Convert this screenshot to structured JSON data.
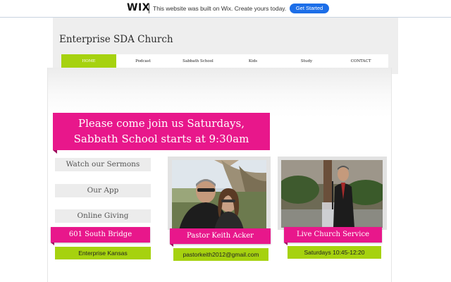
{
  "wix_banner": {
    "logo": "WIX",
    "message": "This website was built on Wix. Create yours today.",
    "cta": "Get Started"
  },
  "site": {
    "title": "Enterprise SDA Church"
  },
  "nav": {
    "items": [
      {
        "label": "HOME",
        "active": true
      },
      {
        "label": "Podcast",
        "active": false
      },
      {
        "label": "Sabbath School",
        "active": false
      },
      {
        "label": "Kids",
        "active": false
      },
      {
        "label": "Study",
        "active": false
      },
      {
        "label": "CONTACT",
        "active": false
      }
    ]
  },
  "hero": {
    "line1": "Please come join us Saturdays,",
    "line2": "Sabbath School starts at 9:30am"
  },
  "left_buttons": {
    "sermons": "Watch our Sermons",
    "app": "Our App",
    "giving": "Online Giving"
  },
  "address": {
    "street": "601 South Bridge",
    "city": "Enterprise Kansas"
  },
  "pastor": {
    "name": "Pastor Keith Acker",
    "email": "pastorkeith2012@gmail.com"
  },
  "live": {
    "title": "Live Church Service",
    "time": "Saturdays 10:45-12:20"
  },
  "colors": {
    "accent_pink": "#e8178b",
    "accent_green": "#a6d20f",
    "wix_blue": "#1c6ee8"
  }
}
